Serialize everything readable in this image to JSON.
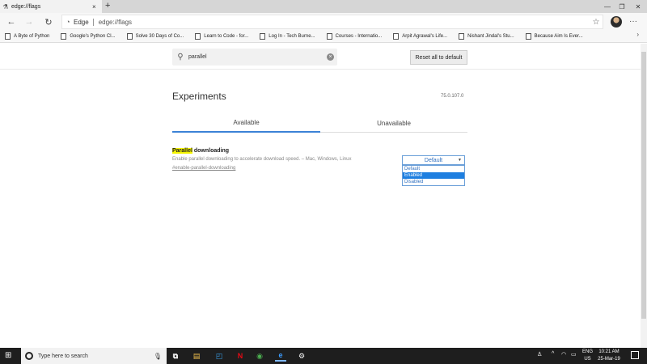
{
  "browser": {
    "tab": {
      "icon": "flask-icon",
      "title": "edge://flags",
      "close": "×"
    },
    "new_tab": "+",
    "window_controls": {
      "minimize": "—",
      "restore": "❐",
      "close": "✕"
    },
    "nav": {
      "back": "←",
      "forward": "→",
      "refresh": "↻"
    },
    "address": {
      "site_label": "Edge",
      "url": "edge://flags",
      "favorite": "☆"
    },
    "menu": "···"
  },
  "bookmarks": [
    {
      "label": "A Byte of Python"
    },
    {
      "label": "Google's Python Cl..."
    },
    {
      "label": "Solve 30 Days of Co..."
    },
    {
      "label": "Learn to Code - for..."
    },
    {
      "label": "Log In - Tech Burne..."
    },
    {
      "label": "Courses - Internatio..."
    },
    {
      "label": "Arpit Agrawal's Life..."
    },
    {
      "label": "Nishant Jindal's Stu..."
    },
    {
      "label": "Because Aim Is Ever..."
    }
  ],
  "bookmarks_more": "›",
  "flags_page": {
    "search": {
      "value": "parallel",
      "clear": "×"
    },
    "reset_button": "Reset all to default",
    "title": "Experiments",
    "version": "75.0.107.0",
    "tabs": [
      {
        "label": "Available"
      },
      {
        "label": "Unavailable"
      }
    ],
    "flag": {
      "title_highlight": "Parallel",
      "title_rest": " downloading",
      "description": "Enable parallel downloading to accelerate download speed. – Mac, Windows, Linux",
      "link": "#enable-parallel-downloading",
      "select_value": "Default",
      "options": [
        {
          "label": "Default",
          "selected": false
        },
        {
          "label": "Enabled",
          "selected": true
        },
        {
          "label": "Disabled",
          "selected": false
        }
      ]
    }
  },
  "taskbar": {
    "search_placeholder": "Type here to search",
    "apps": [
      {
        "name": "task-view",
        "glyph": "⧉"
      },
      {
        "name": "file-explorer",
        "glyph": "▤"
      },
      {
        "name": "store",
        "glyph": "◰"
      },
      {
        "name": "netflix",
        "glyph": "N"
      },
      {
        "name": "chrome",
        "glyph": "◉"
      },
      {
        "name": "edge",
        "glyph": "e"
      },
      {
        "name": "settings",
        "glyph": "⚙"
      }
    ],
    "lang_top": "ENG",
    "lang_bottom": "US",
    "time": "10:21 AM",
    "date": "25-Mar-19"
  }
}
